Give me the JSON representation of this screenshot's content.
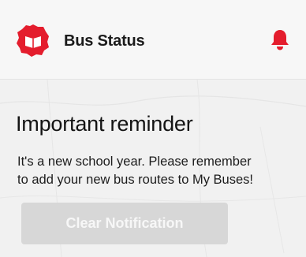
{
  "app": {
    "title": "Bus Status",
    "logo_icon": "red-badge-book-icon",
    "notification_icon": "bell-icon",
    "accent_color": "#e41d2d"
  },
  "notification": {
    "title": "Important reminder",
    "message_lines": [
      "It's a new school year. Please remember",
      "to add your new bus routes to My Buses!"
    ],
    "clear_label": "Clear Notification",
    "clear_enabled": false
  }
}
